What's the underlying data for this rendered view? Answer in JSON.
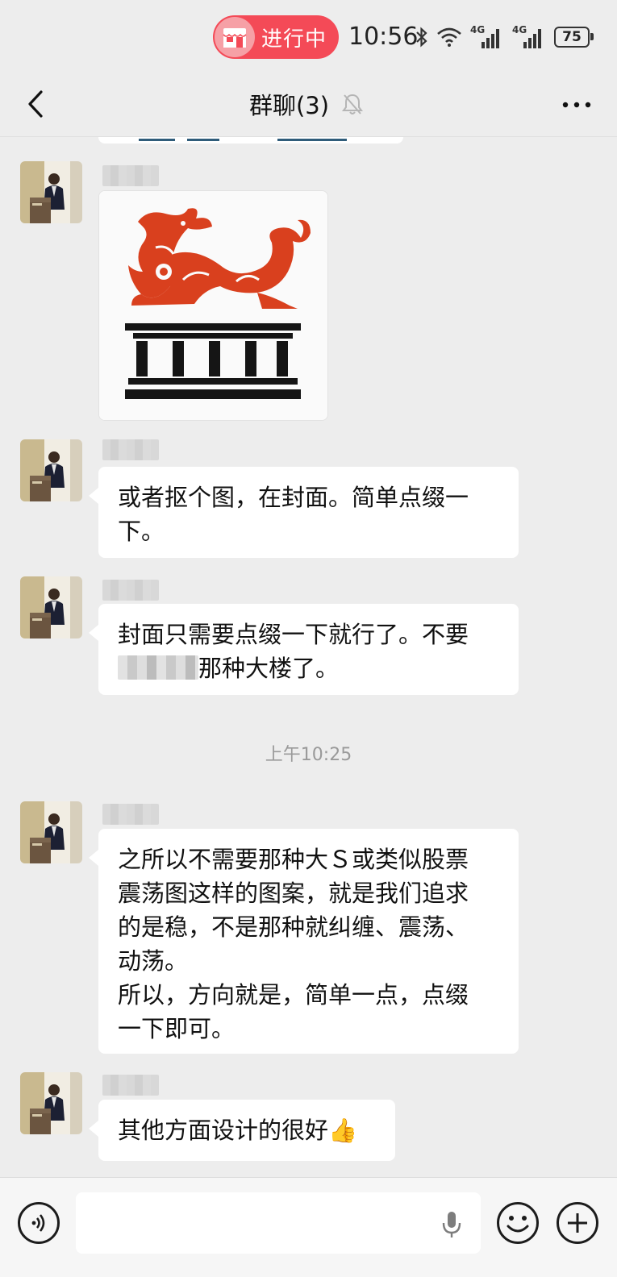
{
  "status_bar": {
    "live_label": "进行中",
    "time": "10:56",
    "battery": "75",
    "network_1": "4G",
    "network_2": "4G"
  },
  "header": {
    "title": "群聊(3)"
  },
  "messages": [
    {
      "type": "image",
      "image_name": "dragon-pillar-logo"
    },
    {
      "type": "text",
      "lines": [
        "或者抠个图，在封面。简单点缀一",
        "下。"
      ]
    },
    {
      "type": "text",
      "lines_pre": "封面只需要点缀一下就行了。不要",
      "line2_suffix": "那种大楼了。"
    },
    {
      "type": "text",
      "lines": [
        "之所以不需要那种大Ｓ或类似股票",
        "震荡图这样的图案，就是我们追求",
        "的是稳，不是那种就纠缠、震荡、",
        "动荡。",
        "所以，方向就是，简单一点，点缀",
        "一下即可。"
      ]
    },
    {
      "type": "text",
      "text": "其他方面设计的很好",
      "emoji": "👍"
    }
  ],
  "timestamp": "上午10:25",
  "input": {
    "value": "",
    "placeholder": ""
  },
  "colors": {
    "background": "#ededed",
    "bubble": "#ffffff",
    "live_pill": "#f44a57",
    "logo_red": "#d9401e"
  },
  "icons": [
    "back-arrow-icon",
    "mute-bell-icon",
    "more-icon",
    "voice-icon",
    "mic-icon",
    "emoji-icon",
    "plus-icon"
  ]
}
